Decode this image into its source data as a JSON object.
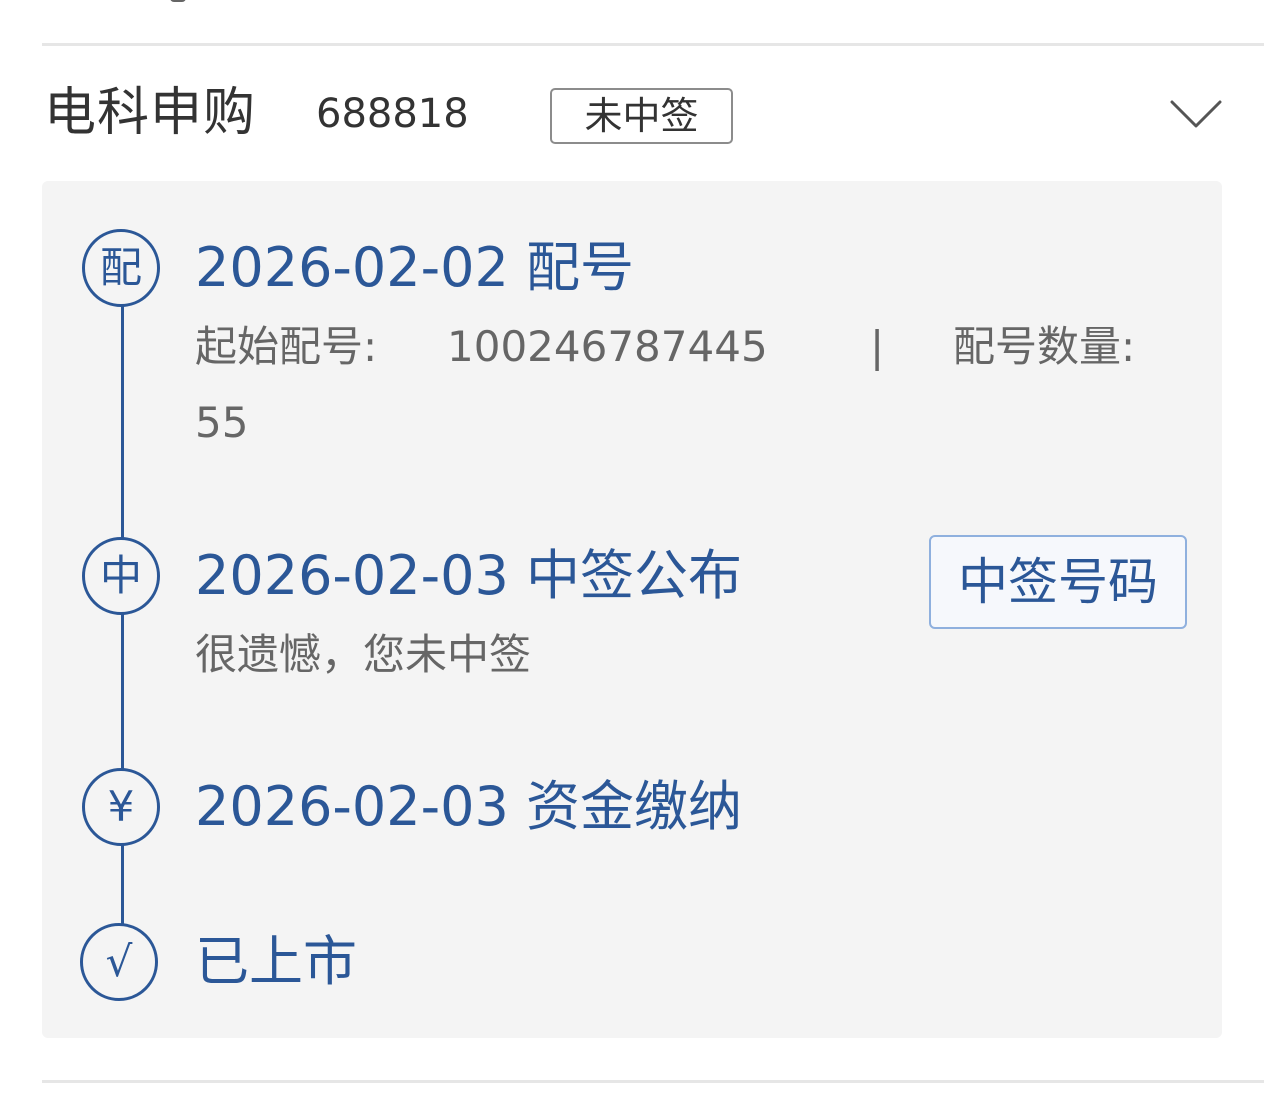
{
  "header": {
    "title": "电科申购",
    "code": "688818",
    "status": "未中签"
  },
  "timeline": {
    "steps": [
      {
        "icon": "配",
        "title": "2026-02-02 配号",
        "start_label": "起始配号:",
        "start_value": "100246787445",
        "separator": "|",
        "count_label": "配号数量:",
        "count_value": "55"
      },
      {
        "icon": "中",
        "title": "2026-02-03 中签公布",
        "detail": "很遗憾，您未中签",
        "button": "中签号码"
      },
      {
        "icon": "¥",
        "title": "2026-02-03 资金缴纳"
      },
      {
        "icon": "√",
        "title": "已上市"
      }
    ]
  },
  "colors": {
    "accent": "#2b5797",
    "panel_bg": "#f4f4f4",
    "text_dark": "#333333",
    "text_gray": "#666666"
  }
}
